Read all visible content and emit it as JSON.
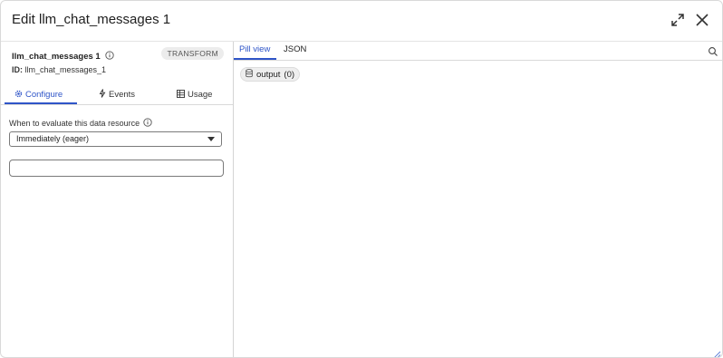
{
  "dialog": {
    "title": "Edit llm_chat_messages 1"
  },
  "resource": {
    "name": "llm_chat_messages 1",
    "badge": "TRANSFORM",
    "id_label": "ID:",
    "id_value": "llm_chat_messages_1"
  },
  "left_tabs": [
    {
      "label": "Configure",
      "icon": "gear-icon"
    },
    {
      "label": "Events",
      "icon": "bolt-icon"
    },
    {
      "label": "Usage",
      "icon": "table-icon"
    }
  ],
  "configure": {
    "eval_label": "When to evaluate this data resource",
    "eval_value": "Immediately (eager)",
    "text_value": ""
  },
  "right_tabs": [
    {
      "label": "Pill view"
    },
    {
      "label": "JSON"
    }
  ],
  "pills": [
    {
      "label": "output",
      "count": "(0)",
      "icon": "database-icon"
    }
  ],
  "colors": {
    "accent": "#2f55c8"
  }
}
